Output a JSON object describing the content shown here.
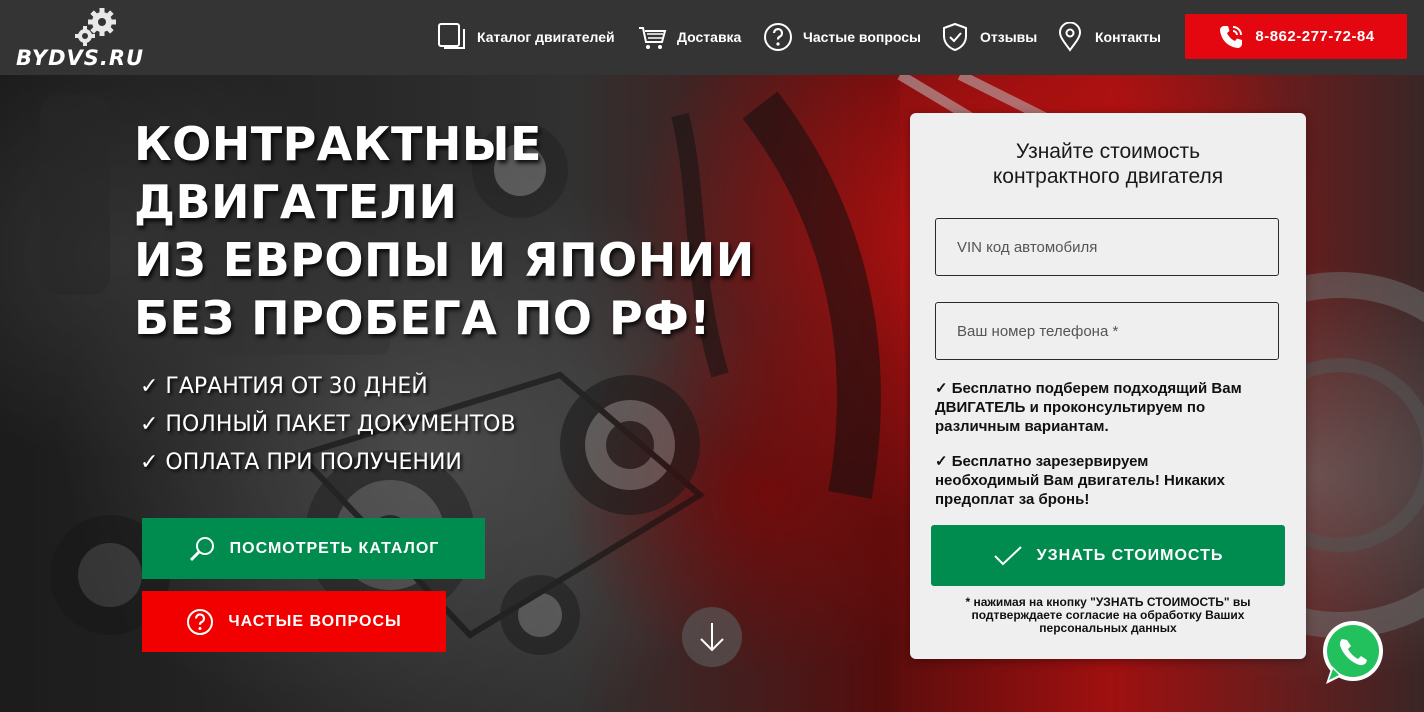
{
  "header": {
    "logo_text": "BYDVS.RU",
    "nav": [
      {
        "label": "Каталог двигателей",
        "icon": "catalog-icon"
      },
      {
        "label": "Доставка",
        "icon": "cart-icon"
      },
      {
        "label": "Частые вопросы",
        "icon": "question-icon"
      },
      {
        "label": "Отзывы",
        "icon": "shield-icon"
      },
      {
        "label": "Контакты",
        "icon": "location-pin-icon"
      }
    ],
    "phone": "8-862-277-72-84"
  },
  "hero": {
    "title_lines": [
      "КОНТРАКТНЫЕ",
      "ДВИГАТЕЛИ",
      "ИЗ ЕВРОПЫ И ЯПОНИИ",
      "БЕЗ ПРОБЕГА ПО РФ!"
    ],
    "benefits": [
      "✓ ГАРАНТИЯ ОТ 30 ДНЕЙ",
      "✓ ПОЛНЫЙ ПАКЕТ ДОКУМЕНТОВ",
      "✓ ОПЛАТА ПРИ ПОЛУЧЕНИИ"
    ],
    "catalog_button": "ПОСМОТРЕТЬ КАТАЛОГ",
    "faq_button": "ЧАСТЫЕ ВОПРОСЫ"
  },
  "form": {
    "title_lines": [
      "Узнайте стоимость",
      "контрактного двигателя"
    ],
    "vin_placeholder": "VIN код автомобиля",
    "phone_placeholder": "Ваш номер телефона *",
    "note1_lines": [
      "✓ Бесплатно подберем подходящий Вам",
      "ДВИГАТЕЛЬ и проконсультируем по",
      "различным вариантам."
    ],
    "note2_lines": [
      "✓ Бесплатно зарезервируем",
      "необходимый Вам двигатель! Никаких",
      "предоплат за бронь!"
    ],
    "submit_button": "УЗНАТЬ СТОИМОСТЬ",
    "consent_lines": [
      "* нажимая на кнопку \"УЗНАТЬ СТОИМОСТЬ\" вы",
      "подтверждаете согласие на обработку Ваших",
      "персональных данных"
    ]
  },
  "colors": {
    "header_bg": "#343434",
    "accent_red": "#e4070f",
    "accent_green": "#008c4f",
    "form_bg": "#efefef"
  }
}
